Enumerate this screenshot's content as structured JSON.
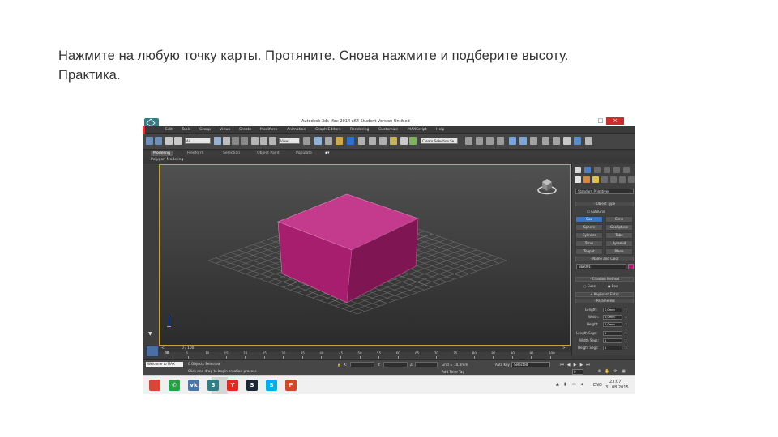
{
  "slide": {
    "line1": "Нажмите на любую точку карты. Протяните. Снова нажмите и подберите высоту.",
    "line2": "Практика."
  },
  "window": {
    "title": "Autodesk 3ds Max 2014 x64      Student Version      Untitled",
    "minimize": "–",
    "maximize": "□",
    "close": "×"
  },
  "menu": [
    "Edit",
    "Tools",
    "Group",
    "Views",
    "Create",
    "Modifiers",
    "Animation",
    "Graph Editors",
    "Rendering",
    "Customize",
    "MAXScript",
    "Help"
  ],
  "toolbar": {
    "filter_value": "All",
    "coord_value": "View",
    "selection_set": "Create Selection Se"
  },
  "ribbon": {
    "tabs": [
      "Modeling",
      "Freeform",
      "Selection",
      "Object Paint",
      "Populate"
    ],
    "active_tab": "Modeling",
    "sub_label": "Polygon Modeling"
  },
  "viewport": {
    "label": "+ ][ Perspective ][ Realistic ]",
    "box_color": "#b01a72",
    "nav_arrow": "▼"
  },
  "command_panel": {
    "category": "Standard Primitives",
    "object_type_title": "- Object Type",
    "autogrid": "AutoGrid",
    "buttons": [
      "Box",
      "Cone",
      "Sphere",
      "GeoSphere",
      "Cylinder",
      "Tube",
      "Torus",
      "Pyramid",
      "Teapot",
      "Plane"
    ],
    "active_button": "Box",
    "name_color_title": "- Name and Color",
    "object_name": "Box001",
    "object_color": "#b01a72",
    "creation_title": "- Creation Method",
    "creation_cube": "Cube",
    "creation_box": "Box",
    "keyboard_title": "+ Keyboard Entry",
    "parameters_title": "- Parameters",
    "params": [
      {
        "label": "Length:",
        "value": "0,0mm"
      },
      {
        "label": "Width:",
        "value": "0,0mm"
      },
      {
        "label": "Height:",
        "value": "0,0mm"
      },
      {
        "label": "Length Segs:",
        "value": "1"
      },
      {
        "label": "Width Segs:",
        "value": "1"
      },
      {
        "label": "Height Segs:",
        "value": "1"
      }
    ]
  },
  "timeline": {
    "slider_label": "0 / 100",
    "prev": "<",
    "next": ">",
    "ticks": [
      "0",
      "5",
      "10",
      "15",
      "20",
      "25",
      "30",
      "35",
      "40",
      "45",
      "50",
      "55",
      "60",
      "65",
      "70",
      "75",
      "80",
      "85",
      "90",
      "95",
      "100"
    ]
  },
  "status": {
    "maxscript": "Welcome to MAX",
    "selection": "0 Objects Selected",
    "prompt": "Click and drag to begin creation process",
    "x_label": "X:",
    "y_label": "Y:",
    "z_label": "Z:",
    "grid": "Grid = 10,0mm",
    "add_time_tag": "Add Time Tag",
    "auto_key": "Auto Key",
    "selected_value": "Selected",
    "frame": "0"
  },
  "taskbar": {
    "icons": [
      {
        "name": "chrome-icon",
        "glyph": "",
        "color": "#db4437"
      },
      {
        "name": "whatsapp-icon",
        "glyph": "✆",
        "color": "#25a244"
      },
      {
        "name": "vk-icon",
        "glyph": "vk",
        "color": "#4a76a8"
      },
      {
        "name": "3dsmax-icon",
        "glyph": "3",
        "color": "#2e7f86"
      },
      {
        "name": "yandex-icon",
        "glyph": "Y",
        "color": "#e52620"
      },
      {
        "name": "steam-icon",
        "glyph": "S",
        "color": "#1b2838"
      },
      {
        "name": "skype-icon",
        "glyph": "S",
        "color": "#00aff0"
      },
      {
        "name": "powerpoint-icon",
        "glyph": "P",
        "color": "#d24726"
      }
    ],
    "lang": "ENG",
    "time": "23:07",
    "date": "31.08.2015"
  }
}
